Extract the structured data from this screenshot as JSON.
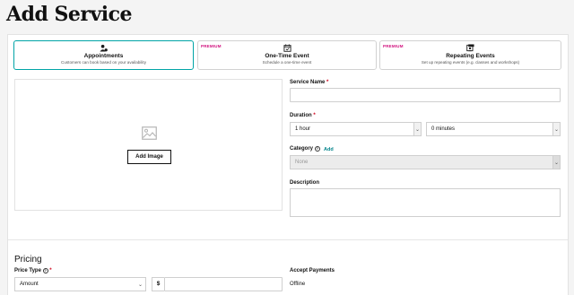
{
  "page": {
    "title": "Add Service"
  },
  "service_types": [
    {
      "label": "Appointments",
      "description": "Customers can book based on your availability",
      "badge": "",
      "icon": "appointments-icon",
      "selected": true
    },
    {
      "label": "One-Time Event",
      "description": "Schedule a one-time event",
      "badge": "PREMIUM",
      "icon": "calendar-check-icon",
      "selected": false
    },
    {
      "label": "Repeating Events",
      "description": "Set up repeating events (e.g. classes and workshops)",
      "badge": "PREMIUM",
      "icon": "repeating-events-icon",
      "selected": false
    }
  ],
  "image": {
    "button_label": "Add Image",
    "icon": "image-placeholder-icon"
  },
  "form": {
    "service_name": {
      "label": "Service Name",
      "required": "*",
      "value": ""
    },
    "duration": {
      "label": "Duration",
      "required": "*",
      "hours": "1 hour",
      "minutes": "0 minutes"
    },
    "category": {
      "label": "Category",
      "add_label": "Add",
      "value": "None"
    },
    "description": {
      "label": "Description",
      "value": ""
    }
  },
  "pricing": {
    "title": "Pricing",
    "price_type": {
      "label": "Price Type",
      "required": "*",
      "value": "Amount"
    },
    "currency_symbol": "$",
    "accept_payments": {
      "label": "Accept Payments",
      "value": "Offline"
    }
  },
  "colors": {
    "accent": "#00a4a6",
    "premium": "#d1117e",
    "required": "#d0021b",
    "link": "#00838a"
  }
}
